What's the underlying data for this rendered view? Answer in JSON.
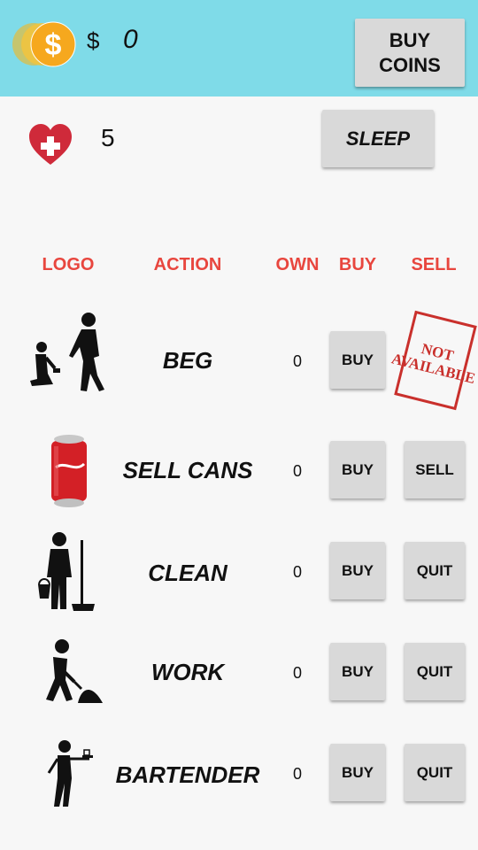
{
  "header": {
    "currency_symbol": "$",
    "coins": "0",
    "buy_coins_label": "BUY\nCOINS"
  },
  "status": {
    "health": "5",
    "sleep_label": "SLEEP"
  },
  "table": {
    "columns": {
      "logo": "LOGO",
      "action": "ACTION",
      "own": "OWN",
      "buy": "BUY",
      "sell": "SELL"
    },
    "rows": [
      {
        "action": "BEG",
        "own": "0",
        "buy_label": "BUY",
        "sell_label": "",
        "stamp": "NOT\nAVAILABLE",
        "icon": "beggar-icon"
      },
      {
        "action": "SELL CANS",
        "own": "0",
        "buy_label": "BUY",
        "sell_label": "SELL",
        "icon": "soda-can-icon"
      },
      {
        "action": "CLEAN",
        "own": "0",
        "buy_label": "BUY",
        "sell_label": "QUIT",
        "icon": "janitor-icon"
      },
      {
        "action": "WORK",
        "own": "0",
        "buy_label": "BUY",
        "sell_label": "QUIT",
        "icon": "worker-shovel-icon"
      },
      {
        "action": "BARTENDER",
        "own": "0",
        "buy_label": "BUY",
        "sell_label": "QUIT",
        "icon": "waiter-icon"
      }
    ]
  },
  "colors": {
    "topbar": "#7fdbe8",
    "header_text": "#e8463e",
    "button": "#d9d9d9",
    "stamp": "#c9302c"
  }
}
